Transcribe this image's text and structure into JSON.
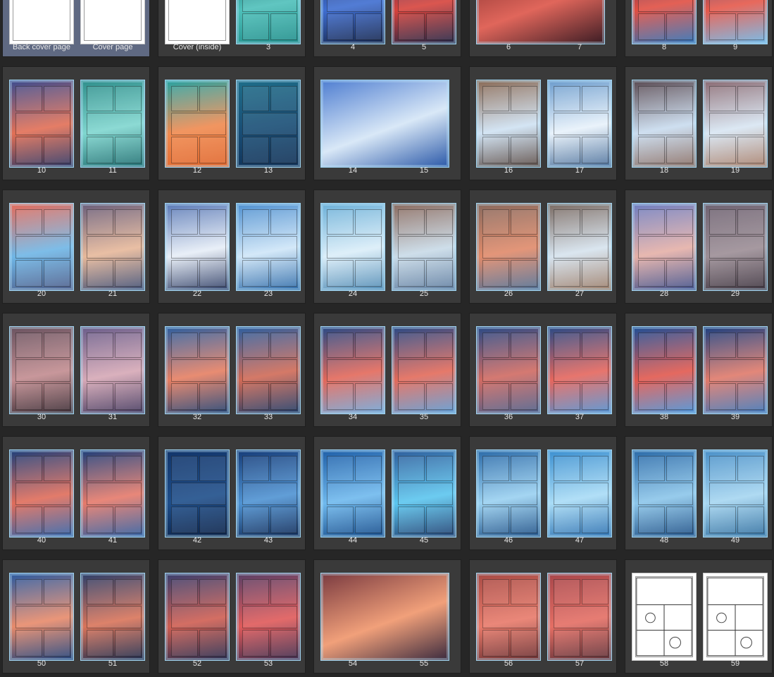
{
  "rows": [
    [
      {
        "selected": true,
        "pages": [
          {
            "label": "Back cover page",
            "blank": true
          },
          {
            "label": "Cover page",
            "blank": true
          }
        ]
      },
      {
        "pages": [
          {
            "label": "Cover (inside)",
            "blank": true
          },
          {
            "label": "3",
            "colors": [
              "#0f5f63",
              "#4ec0ba",
              "#1e8c89"
            ]
          }
        ]
      },
      {
        "pages": [
          {
            "label": "4",
            "colors": [
              "#1a2a5a",
              "#3f6ed1",
              "#14244a"
            ]
          },
          {
            "label": "5",
            "colors": [
              "#2c2e5e",
              "#d7433c",
              "#1f2444"
            ]
          }
        ]
      },
      {
        "wide": true,
        "pages": [
          {
            "label": "6",
            "colors": [
              "#7b2a2a",
              "#e0665b",
              "#3b1c24"
            ]
          },
          {
            "label": "7"
          }
        ]
      },
      {
        "pages": [
          {
            "label": "8",
            "colors": [
              "#3a2a5e",
              "#e14f42",
              "#2a6fb6"
            ]
          },
          {
            "label": "9",
            "colors": [
              "#2b3a74",
              "#e6584a",
              "#6cb6e7"
            ]
          }
        ]
      }
    ],
    [
      {
        "pages": [
          {
            "label": "10",
            "colors": [
              "#3d4c8f",
              "#e26f55",
              "#2c3563"
            ]
          },
          {
            "label": "11",
            "colors": [
              "#2f8f8c",
              "#7fd6cf",
              "#1e6e70"
            ]
          }
        ]
      },
      {
        "pages": [
          {
            "label": "12",
            "colors": [
              "#28a3a3",
              "#f08a4f",
              "#e0652b"
            ]
          },
          {
            "label": "13",
            "colors": [
              "#1f6e8a",
              "#184c74",
              "#0f2f55"
            ]
          }
        ]
      },
      {
        "wide": true,
        "pages": [
          {
            "label": "14",
            "colors": [
              "#4f7ed1",
              "#d9e8f7",
              "#2a58a8"
            ]
          },
          {
            "label": "15"
          }
        ]
      },
      {
        "pages": [
          {
            "label": "16",
            "colors": [
              "#8a6a55",
              "#cfe2f3",
              "#5a4a44"
            ]
          },
          {
            "label": "17",
            "colors": [
              "#6c9ccd",
              "#e8f2fb",
              "#4a6f9a"
            ]
          }
        ]
      },
      {
        "pages": [
          {
            "label": "18",
            "colors": [
              "#5a4a52",
              "#c9dcef",
              "#8a6e64"
            ]
          },
          {
            "label": "19",
            "colors": [
              "#8a6a72",
              "#d8e6f3",
              "#a87f6a"
            ]
          }
        ]
      }
    ],
    [
      {
        "pages": [
          {
            "label": "20",
            "colors": [
              "#e56b5a",
              "#6fb6e6",
              "#4d5d8a"
            ]
          },
          {
            "label": "21",
            "colors": [
              "#6a5e7a",
              "#e7b89a",
              "#3f4e74"
            ]
          }
        ]
      },
      {
        "pages": [
          {
            "label": "22",
            "colors": [
              "#5a79b6",
              "#e7eef7",
              "#2f3e66"
            ]
          },
          {
            "label": "23",
            "colors": [
              "#4f90d0",
              "#cfe6f8",
              "#2d6aa8"
            ]
          }
        ]
      },
      {
        "pages": [
          {
            "label": "24",
            "colors": [
              "#6cb0d8",
              "#dbeef9",
              "#4f8ab4"
            ]
          },
          {
            "label": "25",
            "colors": [
              "#8a6a5e",
              "#c9dbe8",
              "#5f7da0"
            ]
          }
        ]
      },
      {
        "pages": [
          {
            "label": "26",
            "colors": [
              "#8a6a5e",
              "#e08a6a",
              "#4e6e94"
            ]
          },
          {
            "label": "27",
            "colors": [
              "#7a6a62",
              "#d6e3ee",
              "#9c7e6a"
            ]
          }
        ]
      },
      {
        "pages": [
          {
            "label": "28",
            "colors": [
              "#6f7ec0",
              "#e5b0a8",
              "#3f4f8a"
            ]
          },
          {
            "label": "29",
            "colors": [
              "#6f6372",
              "#9c8e96",
              "#3f3540"
            ]
          }
        ]
      }
    ],
    [
      {
        "pages": [
          {
            "label": "30",
            "colors": [
              "#6a5360",
              "#c28c90",
              "#3b2c34"
            ]
          },
          {
            "label": "31",
            "colors": [
              "#6a5d8a",
              "#d6a8b6",
              "#43385e"
            ]
          }
        ]
      },
      {
        "pages": [
          {
            "label": "32",
            "colors": [
              "#2d5fa0",
              "#e67f63",
              "#1f3f6f"
            ]
          },
          {
            "label": "33",
            "colors": [
              "#2d5fa0",
              "#d06a56",
              "#1d3a66"
            ]
          }
        ]
      },
      {
        "pages": [
          {
            "label": "34",
            "colors": [
              "#2a4a86",
              "#e3685a",
              "#6fa6d9"
            ]
          },
          {
            "label": "35",
            "colors": [
              "#2a4a86",
              "#e36a5a",
              "#5a9ad4"
            ]
          }
        ]
      },
      {
        "pages": [
          {
            "label": "36",
            "colors": [
              "#2a4a86",
              "#d06a62",
              "#4b5e8a"
            ]
          },
          {
            "label": "37",
            "colors": [
              "#2a4a86",
              "#e5665d",
              "#4f8fd1"
            ]
          }
        ]
      },
      {
        "pages": [
          {
            "label": "38",
            "colors": [
              "#1f4f96",
              "#e2584e",
              "#4690d7"
            ]
          },
          {
            "label": "39",
            "colors": [
              "#1d4080",
              "#e07a6a",
              "#3b74b8"
            ]
          }
        ]
      }
    ],
    [
      {
        "pages": [
          {
            "label": "40",
            "colors": [
              "#1f3f7a",
              "#e06c5a",
              "#2f62a8"
            ]
          },
          {
            "label": "41",
            "colors": [
              "#1f3f7a",
              "#e67a6a",
              "#2d5c9f"
            ]
          }
        ]
      },
      {
        "pages": [
          {
            "label": "42",
            "colors": [
              "#12356a",
              "#1e4e8a",
              "#0a2147"
            ]
          },
          {
            "label": "43",
            "colors": [
              "#163c78",
              "#4f93d3",
              "#0f2a57"
            ]
          }
        ]
      },
      {
        "pages": [
          {
            "label": "44",
            "colors": [
              "#1f5fa8",
              "#6fb9ee",
              "#134a8a"
            ]
          },
          {
            "label": "45",
            "colors": [
              "#2f5e9c",
              "#5cc6ef",
              "#1e3e70"
            ]
          }
        ]
      },
      {
        "pages": [
          {
            "label": "46",
            "colors": [
              "#2b6aa8",
              "#9ad1f1",
              "#1d4f86"
            ]
          },
          {
            "label": "47",
            "colors": [
              "#3b8fd0",
              "#a9dcf6",
              "#2a6fb0"
            ]
          }
        ]
      },
      {
        "pages": [
          {
            "label": "48",
            "colors": [
              "#2b6aa8",
              "#8cc6ea",
              "#1d4f86"
            ]
          },
          {
            "label": "49",
            "colors": [
              "#4a90c8",
              "#a6d6f1",
              "#2f6e9f"
            ]
          }
        ]
      }
    ],
    [
      {
        "pages": [
          {
            "label": "50",
            "colors": [
              "#2b5aa0",
              "#e88a6a",
              "#1d3f78"
            ]
          },
          {
            "label": "51",
            "colors": [
              "#2d3f6a",
              "#d9745a",
              "#1c2a4c"
            ]
          }
        ]
      },
      {
        "pages": [
          {
            "label": "52",
            "colors": [
              "#3a3f6e",
              "#cf5e52",
              "#252a4d"
            ]
          },
          {
            "label": "53",
            "colors": [
              "#5a3f66",
              "#e05a5a",
              "#3b2a4c"
            ]
          }
        ]
      },
      {
        "wide": true,
        "pages": [
          {
            "label": "54",
            "colors": [
              "#7a3a40",
              "#f1a07a",
              "#3a2a3e"
            ]
          },
          {
            "label": "55"
          }
        ]
      },
      {
        "pages": [
          {
            "label": "56",
            "colors": [
              "#a84a44",
              "#e87a6a",
              "#6a2e30"
            ]
          },
          {
            "label": "57",
            "colors": [
              "#a8464a",
              "#e46e64",
              "#5e2f36"
            ]
          }
        ]
      },
      {
        "pages": [
          {
            "label": "58",
            "blank": true,
            "sketch": true
          },
          {
            "label": "59",
            "blank": true,
            "sketch": true
          }
        ]
      }
    ]
  ]
}
